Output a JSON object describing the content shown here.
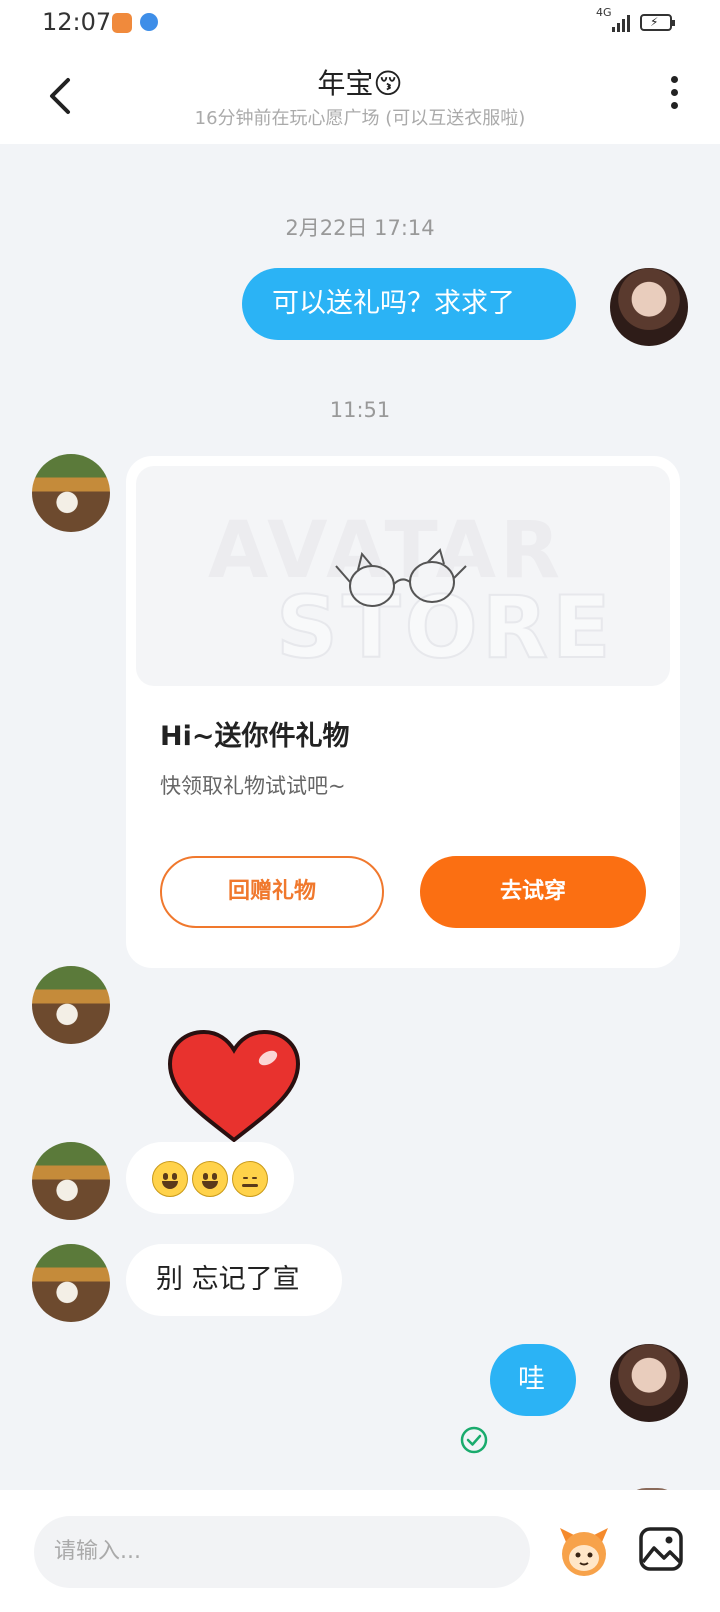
{
  "status_bar": {
    "time": "12:07",
    "network": "4G"
  },
  "header": {
    "title": "年宝😚",
    "subtitle": "16分钟前在玩心愿广场 (可以互送衣服啦)"
  },
  "messages": [
    {
      "type": "timestamp",
      "text": "2月22日 17:14"
    },
    {
      "type": "text_out",
      "text": "可以送礼吗？求求了"
    },
    {
      "type": "timestamp",
      "text": "11:51"
    },
    {
      "type": "gift_card",
      "watermark_line1": "AVATAR",
      "watermark_line2": "STORE",
      "title": "Hi~送你件礼物",
      "desc": "快领取礼物试试吧~",
      "btn_return": "回赠礼物",
      "btn_try": "去试穿"
    },
    {
      "type": "sticker",
      "icon": "red-heart-sticker"
    },
    {
      "type": "emoji_in",
      "emojis": [
        "grinning-face",
        "grinning-face",
        "relieved-face"
      ]
    },
    {
      "type": "text_in",
      "text": "别 忘记了宣"
    },
    {
      "type": "text_out",
      "text": "哇",
      "status": "read"
    }
  ],
  "input": {
    "placeholder": "请输入..."
  },
  "colors": {
    "accent_blue": "#2bb3f5",
    "accent_orange": "#fb6f12",
    "background": "#f2f4f7"
  }
}
